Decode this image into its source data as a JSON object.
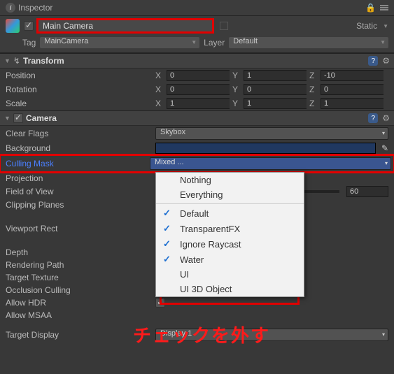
{
  "panel": {
    "title": "Inspector"
  },
  "object": {
    "name": "Main Camera",
    "static_label": "Static",
    "tag_label": "Tag",
    "tag_value": "MainCamera",
    "layer_label": "Layer",
    "layer_value": "Default"
  },
  "transform": {
    "title": "Transform",
    "position": {
      "label": "Position",
      "x": "0",
      "y": "1",
      "z": "-10"
    },
    "rotation": {
      "label": "Rotation",
      "x": "0",
      "y": "0",
      "z": "0"
    },
    "scale": {
      "label": "Scale",
      "x": "1",
      "y": "1",
      "z": "1"
    }
  },
  "camera": {
    "title": "Camera",
    "clear_flags": {
      "label": "Clear Flags",
      "value": "Skybox"
    },
    "background": {
      "label": "Background",
      "color": "#203860"
    },
    "culling_mask": {
      "label": "Culling Mask",
      "value": "Mixed ..."
    },
    "projection": {
      "label": "Projection"
    },
    "fov": {
      "label": "Field of View",
      "value": "60",
      "percent": 30
    },
    "clipping": {
      "label": "Clipping Planes"
    },
    "viewport": {
      "label": "Viewport Rect"
    },
    "depth": {
      "label": "Depth"
    },
    "rendering_path": {
      "label": "Rendering Path"
    },
    "target_texture": {
      "label": "Target Texture"
    },
    "occlusion": {
      "label": "Occlusion Culling"
    },
    "allow_hdr": {
      "label": "Allow HDR"
    },
    "allow_msaa": {
      "label": "Allow MSAA"
    },
    "target_display": {
      "label": "Target Display",
      "value": "Display 1"
    }
  },
  "culling_popup": {
    "items": [
      {
        "label": "Nothing",
        "checked": false
      },
      {
        "label": "Everything",
        "checked": false
      },
      {
        "label": "Default",
        "checked": true
      },
      {
        "label": "TransparentFX",
        "checked": true
      },
      {
        "label": "Ignore Raycast",
        "checked": true
      },
      {
        "label": "Water",
        "checked": true
      },
      {
        "label": "UI",
        "checked": false
      },
      {
        "label": "UI 3D Object",
        "checked": false
      }
    ]
  },
  "annotation": {
    "text": "チェックを外す"
  }
}
